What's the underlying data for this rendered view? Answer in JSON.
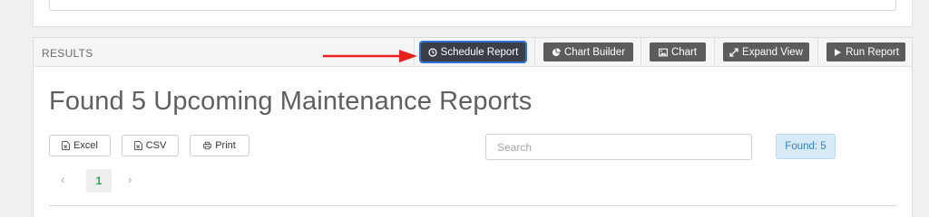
{
  "panel": {
    "title": "RESULTS",
    "toolbar": {
      "schedule_report": "Schedule Report",
      "chart_builder": "Chart Builder",
      "chart": "Chart",
      "expand_view": "Expand View",
      "run_report": "Run Report"
    },
    "accent_color": "#2f6fd6",
    "annotation_arrow_color": "#e8201e"
  },
  "heading": "Found 5 Upcoming Maintenance Reports",
  "export": {
    "excel": "Excel",
    "csv": "CSV",
    "print": "Print"
  },
  "search": {
    "placeholder": "Search",
    "value": ""
  },
  "found_badge": "Found: 5",
  "pagination": {
    "prev": "‹",
    "current_page": "1",
    "next": "›"
  }
}
